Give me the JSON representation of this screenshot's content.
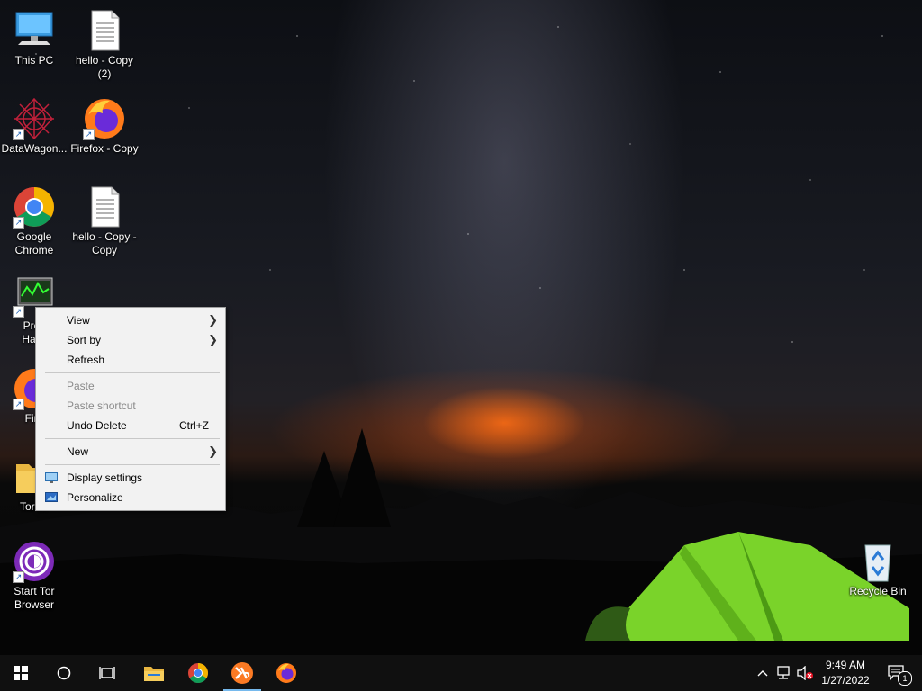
{
  "desktop_icons": [
    {
      "label": "This PC"
    },
    {
      "label": "hello - Copy (2)"
    },
    {
      "label": "DataWagon..."
    },
    {
      "label": "Firefox - Copy"
    },
    {
      "label": "Google Chrome"
    },
    {
      "label": "hello - Copy - Copy"
    },
    {
      "label": "Proc Hack"
    },
    {
      "label": "Fire"
    },
    {
      "label": "Tor Br"
    },
    {
      "label": "Start Tor Browser"
    },
    {
      "label": "Recycle Bin"
    }
  ],
  "context_menu": {
    "view": "View",
    "sort_by": "Sort by",
    "refresh": "Refresh",
    "paste": "Paste",
    "paste_shortcut": "Paste shortcut",
    "undo_delete": "Undo Delete",
    "undo_delete_shortcut": "Ctrl+Z",
    "new": "New",
    "display_settings": "Display settings",
    "personalize": "Personalize"
  },
  "taskbar": {
    "time": "9:49 AM",
    "date": "1/27/2022",
    "notification_count": "1"
  },
  "colors": {
    "accent": "#76b9ed",
    "menu_bg": "#f2f2f2",
    "taskbar_bg": "#101010"
  }
}
